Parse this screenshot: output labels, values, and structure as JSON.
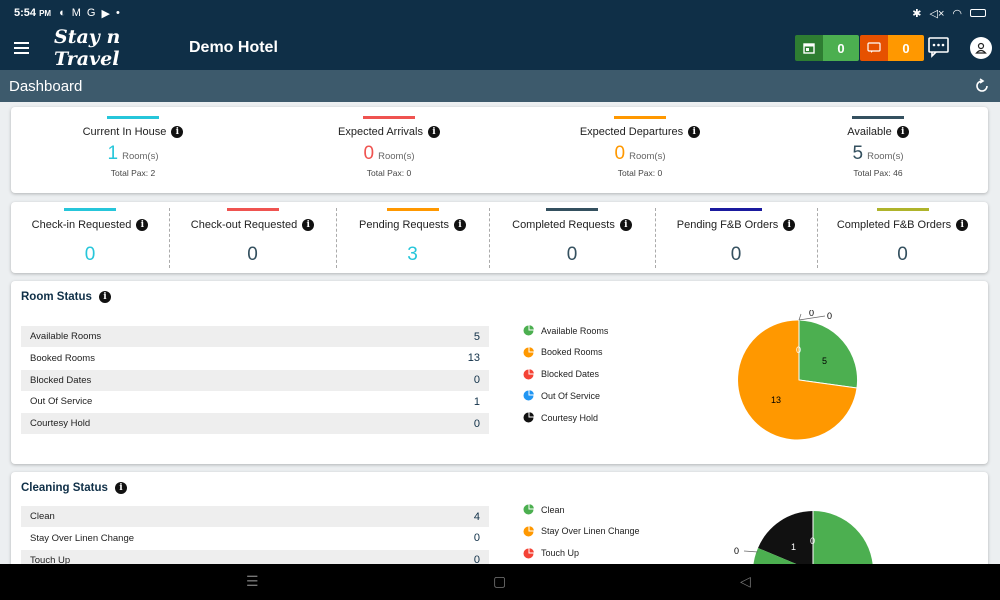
{
  "status_bar": {
    "time": "5:54",
    "ampm": "PM"
  },
  "app_bar": {
    "logo": "Stay n Travel",
    "hotel_name": "Demo Hotel",
    "calendar_count": "0",
    "requests_count": "0"
  },
  "page_title": "Dashboard",
  "colors": {
    "teal": "#26c6da",
    "red": "#ef5350",
    "orange": "#ff9800",
    "navy": "#34505f",
    "indigo": "#1a1a9e",
    "olive": "#afb42b",
    "green": "#4caf50",
    "blue": "#2196f3",
    "black": "#111111",
    "header": "#0f2f47"
  },
  "occupancy": [
    {
      "label": "Current In House",
      "value": "1",
      "unit": "Room(s)",
      "pax": "Total Pax: 2",
      "color": "#26c6da"
    },
    {
      "label": "Expected Arrivals",
      "value": "0",
      "unit": "Room(s)",
      "pax": "Total Pax: 0",
      "color": "#ef5350"
    },
    {
      "label": "Expected Departures",
      "value": "0",
      "unit": "Room(s)",
      "pax": "Total Pax: 0",
      "color": "#ff9800"
    },
    {
      "label": "Available",
      "value": "5",
      "unit": "Room(s)",
      "pax": "Total Pax: 46",
      "color": "#34505f"
    }
  ],
  "requests": [
    {
      "label": "Check-in Requested",
      "value": "0",
      "color": "#26c6da",
      "val_color": "#26c6da"
    },
    {
      "label": "Check-out Requested",
      "value": "0",
      "color": "#ef5350",
      "val_color": "#34505f"
    },
    {
      "label": "Pending Requests",
      "value": "3",
      "color": "#ff9800",
      "val_color": "#26c6da"
    },
    {
      "label": "Completed Requests",
      "value": "0",
      "color": "#34505f",
      "val_color": "#34505f"
    },
    {
      "label": "Pending F&B Orders",
      "value": "0",
      "color": "#1a1a9e",
      "val_color": "#34505f"
    },
    {
      "label": "Completed F&B Orders",
      "value": "0",
      "color": "#afb42b",
      "val_color": "#34505f"
    }
  ],
  "room_status": {
    "title": "Room Status",
    "rows": [
      {
        "label": "Available Rooms",
        "value": "5"
      },
      {
        "label": "Booked Rooms",
        "value": "13"
      },
      {
        "label": "Blocked Dates",
        "value": "0"
      },
      {
        "label": "Out Of Service",
        "value": "1"
      },
      {
        "label": "Courtesy Hold",
        "value": "0"
      }
    ],
    "legend": [
      {
        "label": "Available Rooms",
        "color": "#4caf50"
      },
      {
        "label": "Booked Rooms",
        "color": "#ff9800"
      },
      {
        "label": "Blocked Dates",
        "color": "#f44336"
      },
      {
        "label": "Out Of Service",
        "color": "#2196f3"
      },
      {
        "label": "Courtesy Hold",
        "color": "#111111"
      }
    ],
    "pie_labels": {
      "green": "5",
      "orange": "13",
      "zero_a": "0",
      "zero_b": "0",
      "zero_c": "0"
    }
  },
  "cleaning_status": {
    "title": "Cleaning Status",
    "rows": [
      {
        "label": "Clean",
        "value": "4"
      },
      {
        "label": "Stay Over Linen Change",
        "value": "0"
      },
      {
        "label": "Touch Up",
        "value": "0"
      }
    ],
    "legend": [
      {
        "label": "Clean",
        "color": "#4caf50"
      },
      {
        "label": "Stay Over Linen Change",
        "color": "#ff9800"
      },
      {
        "label": "Touch Up",
        "color": "#f44336"
      }
    ],
    "pie_labels": {
      "black": "1",
      "green": "0",
      "left": "0"
    }
  }
}
